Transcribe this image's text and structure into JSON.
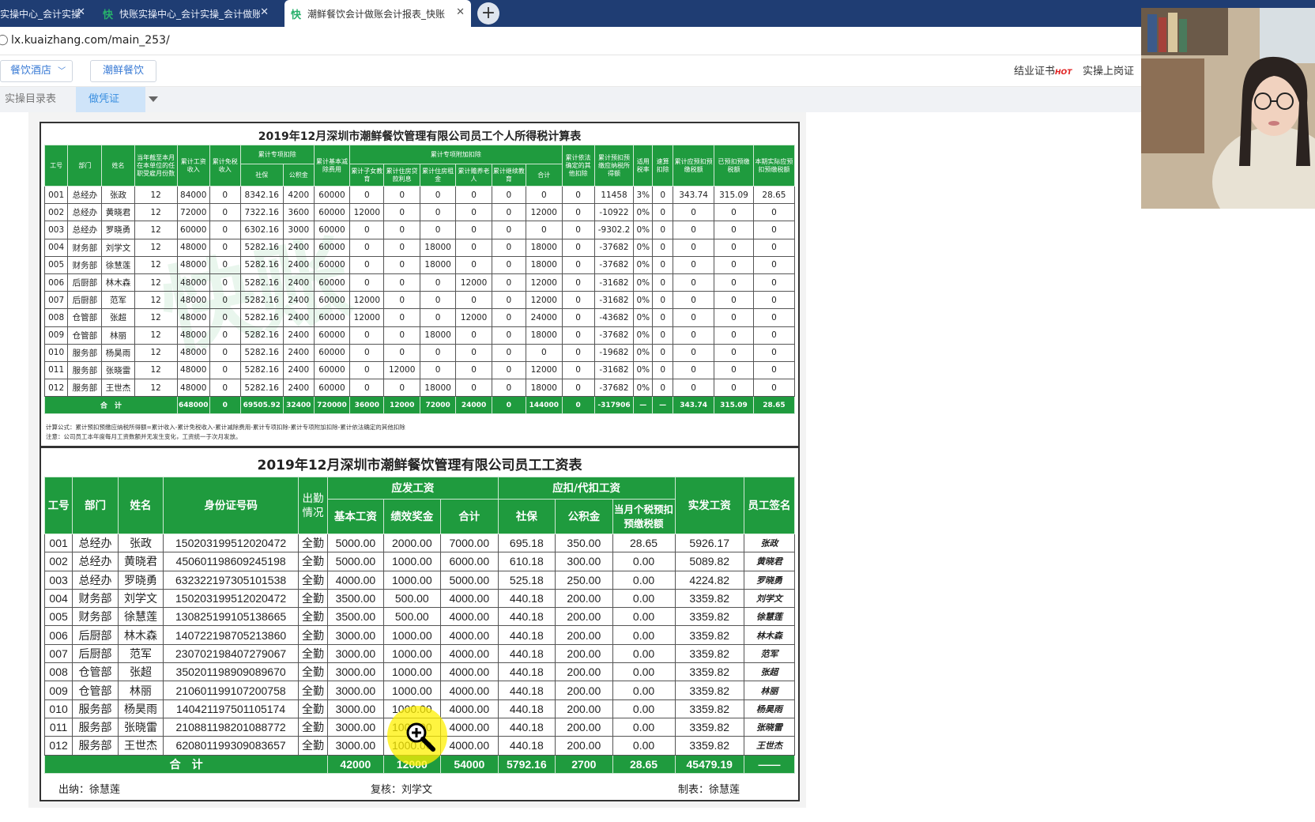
{
  "browser": {
    "tabs": [
      {
        "title": "实操中心_会计实操",
        "active": false
      },
      {
        "title": "快账实操中心_会计实操_会计做账",
        "active": false
      },
      {
        "title": "潮鲜餐饮会计做账会计报表_快账",
        "active": true
      }
    ],
    "tab_favicon": "快",
    "url": "lx.kuaizhang.com/main_253/"
  },
  "appbar": {
    "industry_select": "餐饮酒店",
    "company_button": "潮鲜餐饮",
    "certificate_link": "结业证书",
    "hot_badge": "HOT",
    "onjob_link": "实操上岗证"
  },
  "subtabs": {
    "catalog": "实操目录表",
    "voucher": "做凭证",
    "close": "×"
  },
  "tax_table": {
    "title": "2019年12月深圳市潮鲜餐饮管理有限公司员工个人所得税计算表",
    "headers": {
      "id": "工号",
      "dept": "部门",
      "name": "姓名",
      "months": "当年截至本月在本单位的任职受雇月份数",
      "income": "累计工资收入",
      "exempt": "累计免税收入",
      "special": "累计专项扣除",
      "social": "社保",
      "fund": "公积金",
      "basic": "累计基本减除费用",
      "add_special": "累计专项附加扣除",
      "child": "累计子女教育",
      "loan": "累计住房贷款利息",
      "rent": "累计住房租金",
      "elder": "累计赡养老人",
      "edu": "累计继续教育",
      "sum": "合计",
      "other": "累计依法确定的其他扣除",
      "taxable": "累计预扣预缴应纳税所得额",
      "rate": "适用税率",
      "quick": "速算扣除",
      "payable": "累计应预扣预缴税额",
      "paid": "已预扣预缴税额",
      "current": "本期实际应预扣预缴税额"
    },
    "rows": [
      [
        "001",
        "总经办",
        "张政",
        "12",
        "84000",
        "0",
        "8342.16",
        "4200",
        "60000",
        "0",
        "0",
        "0",
        "0",
        "0",
        "0",
        "0",
        "11458",
        "3%",
        "0",
        "343.74",
        "315.09",
        "28.65"
      ],
      [
        "002",
        "总经办",
        "黄晓君",
        "12",
        "72000",
        "0",
        "7322.16",
        "3600",
        "60000",
        "12000",
        "0",
        "0",
        "0",
        "0",
        "12000",
        "0",
        "-10922",
        "0%",
        "0",
        "0",
        "0",
        "0"
      ],
      [
        "003",
        "总经办",
        "罗晓勇",
        "12",
        "60000",
        "0",
        "6302.16",
        "3000",
        "60000",
        "0",
        "0",
        "0",
        "0",
        "0",
        "0",
        "0",
        "-9302.2",
        "0%",
        "0",
        "0",
        "0",
        "0"
      ],
      [
        "004",
        "财务部",
        "刘学文",
        "12",
        "48000",
        "0",
        "5282.16",
        "2400",
        "60000",
        "0",
        "0",
        "18000",
        "0",
        "0",
        "18000",
        "0",
        "-37682",
        "0%",
        "0",
        "0",
        "0",
        "0"
      ],
      [
        "005",
        "财务部",
        "徐慧莲",
        "12",
        "48000",
        "0",
        "5282.16",
        "2400",
        "60000",
        "0",
        "0",
        "18000",
        "0",
        "0",
        "18000",
        "0",
        "-37682",
        "0%",
        "0",
        "0",
        "0",
        "0"
      ],
      [
        "006",
        "后厨部",
        "林木森",
        "12",
        "48000",
        "0",
        "5282.16",
        "2400",
        "60000",
        "0",
        "0",
        "0",
        "12000",
        "0",
        "12000",
        "0",
        "-31682",
        "0%",
        "0",
        "0",
        "0",
        "0"
      ],
      [
        "007",
        "后厨部",
        "范军",
        "12",
        "48000",
        "0",
        "5282.16",
        "2400",
        "60000",
        "12000",
        "0",
        "0",
        "0",
        "0",
        "12000",
        "0",
        "-31682",
        "0%",
        "0",
        "0",
        "0",
        "0"
      ],
      [
        "008",
        "仓管部",
        "张超",
        "12",
        "48000",
        "0",
        "5282.16",
        "2400",
        "60000",
        "12000",
        "0",
        "0",
        "12000",
        "0",
        "24000",
        "0",
        "-43682",
        "0%",
        "0",
        "0",
        "0",
        "0"
      ],
      [
        "009",
        "仓管部",
        "林丽",
        "12",
        "48000",
        "0",
        "5282.16",
        "2400",
        "60000",
        "0",
        "0",
        "18000",
        "0",
        "0",
        "18000",
        "0",
        "-37682",
        "0%",
        "0",
        "0",
        "0",
        "0"
      ],
      [
        "010",
        "服务部",
        "杨昊雨",
        "12",
        "48000",
        "0",
        "5282.16",
        "2400",
        "60000",
        "0",
        "0",
        "0",
        "0",
        "0",
        "0",
        "0",
        "-19682",
        "0%",
        "0",
        "0",
        "0",
        "0"
      ],
      [
        "011",
        "服务部",
        "张晓雷",
        "12",
        "48000",
        "0",
        "5282.16",
        "2400",
        "60000",
        "0",
        "12000",
        "0",
        "0",
        "0",
        "12000",
        "0",
        "-31682",
        "0%",
        "0",
        "0",
        "0",
        "0"
      ],
      [
        "012",
        "服务部",
        "王世杰",
        "12",
        "48000",
        "0",
        "5282.16",
        "2400",
        "60000",
        "0",
        "0",
        "18000",
        "0",
        "0",
        "18000",
        "0",
        "-37682",
        "0%",
        "0",
        "0",
        "0",
        "0"
      ]
    ],
    "total": [
      "合　计",
      "648000",
      "0",
      "69505.92",
      "32400",
      "720000",
      "36000",
      "12000",
      "72000",
      "24000",
      "0",
      "144000",
      "0",
      "-317906",
      "—",
      "—",
      "343.74",
      "315.09",
      "28.65"
    ],
    "formula": "计算公式：累计预扣预缴应纳税所得额=累计收入-累计免税收入-累计减除费用-累计专项扣除-累计专项附加扣除-累计依法确定的其他扣除",
    "note": "注意：公司员工本年度每月工资数额并无发生变化，工资统一于次月发放。"
  },
  "salary_table": {
    "title": "2019年12月深圳市潮鲜餐饮管理有限公司员工工资表",
    "headers": {
      "id": "工号",
      "dept": "部门",
      "name": "姓名",
      "idcard": "身份证号码",
      "attend": "出勤情况",
      "gross": "应发工资",
      "base": "基本工资",
      "bonus": "绩效奖金",
      "sum": "合计",
      "deduct": "应扣/代扣工资",
      "social": "社保",
      "fund": "公积金",
      "tax": "当月个税预扣预缴税额",
      "net": "实发工资",
      "sign": "员工签名"
    },
    "rows": [
      [
        "001",
        "总经办",
        "张政",
        "150203199512020472",
        "全勤",
        "5000.00",
        "2000.00",
        "7000.00",
        "695.18",
        "350.00",
        "28.65",
        "5926.17",
        "张政"
      ],
      [
        "002",
        "总经办",
        "黄晓君",
        "450601198609245198",
        "全勤",
        "5000.00",
        "1000.00",
        "6000.00",
        "610.18",
        "300.00",
        "0.00",
        "5089.82",
        "黄晓君"
      ],
      [
        "003",
        "总经办",
        "罗晓勇",
        "632322197305101538",
        "全勤",
        "4000.00",
        "1000.00",
        "5000.00",
        "525.18",
        "250.00",
        "0.00",
        "4224.82",
        "罗晓勇"
      ],
      [
        "004",
        "财务部",
        "刘学文",
        "150203199512020472",
        "全勤",
        "3500.00",
        "500.00",
        "4000.00",
        "440.18",
        "200.00",
        "0.00",
        "3359.82",
        "刘学文"
      ],
      [
        "005",
        "财务部",
        "徐慧莲",
        "130825199105138665",
        "全勤",
        "3500.00",
        "500.00",
        "4000.00",
        "440.18",
        "200.00",
        "0.00",
        "3359.82",
        "徐慧莲"
      ],
      [
        "006",
        "后厨部",
        "林木森",
        "140722198705213860",
        "全勤",
        "3000.00",
        "1000.00",
        "4000.00",
        "440.18",
        "200.00",
        "0.00",
        "3359.82",
        "林木森"
      ],
      [
        "007",
        "后厨部",
        "范军",
        "230702198407279067",
        "全勤",
        "3000.00",
        "1000.00",
        "4000.00",
        "440.18",
        "200.00",
        "0.00",
        "3359.82",
        "范军"
      ],
      [
        "008",
        "仓管部",
        "张超",
        "350201198909089670",
        "全勤",
        "3000.00",
        "1000.00",
        "4000.00",
        "440.18",
        "200.00",
        "0.00",
        "3359.82",
        "张超"
      ],
      [
        "009",
        "仓管部",
        "林丽",
        "210601199107200758",
        "全勤",
        "3000.00",
        "1000.00",
        "4000.00",
        "440.18",
        "200.00",
        "0.00",
        "3359.82",
        "林丽"
      ],
      [
        "010",
        "服务部",
        "杨昊雨",
        "140421197501105174",
        "全勤",
        "3000.00",
        "1000.00",
        "4000.00",
        "440.18",
        "200.00",
        "0.00",
        "3359.82",
        "杨昊雨"
      ],
      [
        "011",
        "服务部",
        "张晓雷",
        "210881198201088772",
        "全勤",
        "3000.00",
        "1000.00",
        "4000.00",
        "440.18",
        "200.00",
        "0.00",
        "3359.82",
        "张晓雷"
      ],
      [
        "012",
        "服务部",
        "王世杰",
        "620801199309083657",
        "全勤",
        "3000.00",
        "1000.00",
        "4000.00",
        "440.18",
        "200.00",
        "0.00",
        "3359.82",
        "王世杰"
      ]
    ],
    "total": [
      "合　计",
      "42000",
      "12000",
      "54000",
      "5792.16",
      "2700",
      "28.65",
      "45479.19",
      "——"
    ],
    "cashier": "出纳：徐慧莲",
    "reviewer": "复核：刘学文",
    "preparer": "制表：徐慧莲"
  },
  "watermark": "快账",
  "colors": {
    "header_green": "#1f9b3e",
    "tab_bar": "#1f3d73",
    "link_blue": "#3a7bd5"
  }
}
